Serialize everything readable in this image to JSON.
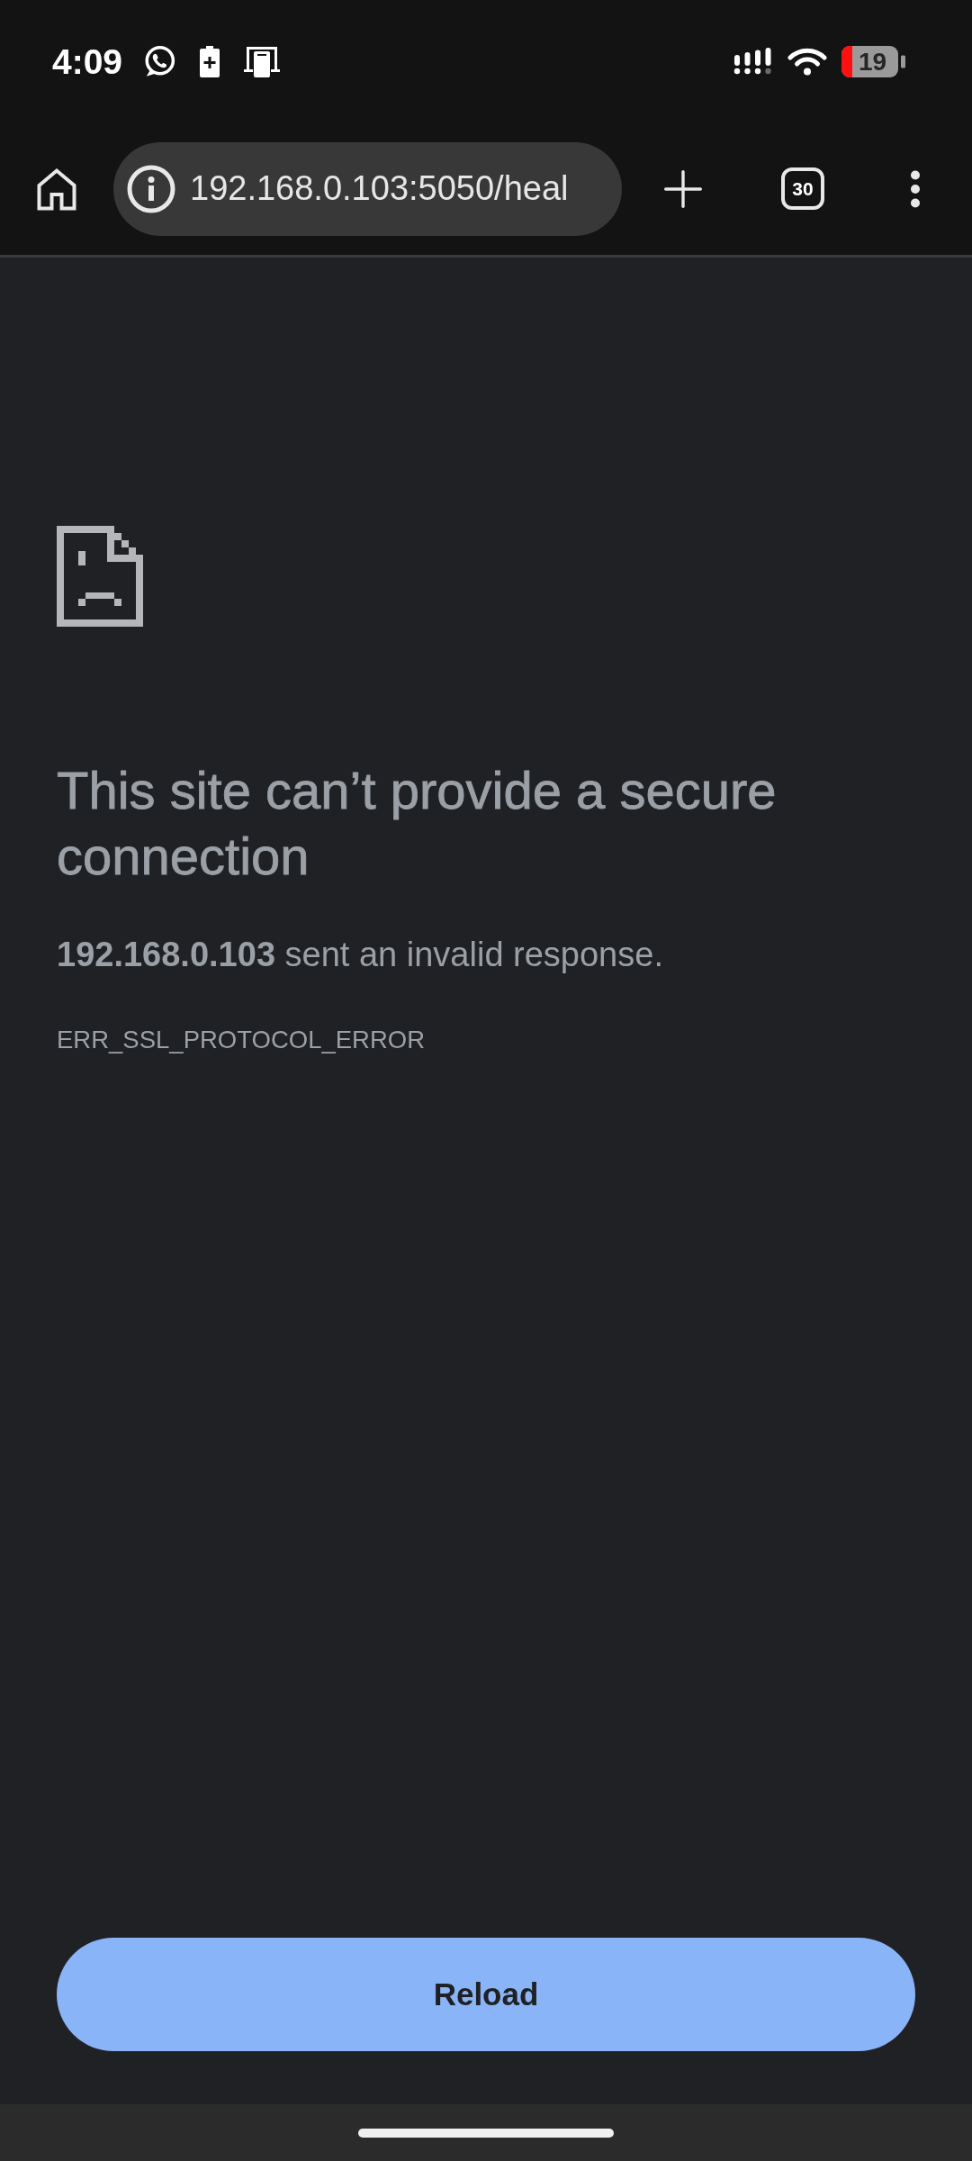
{
  "status_bar": {
    "time": "4:09",
    "battery_percent": "19"
  },
  "toolbar": {
    "url": "192.168.0.103:5050/heal",
    "tab_count": "30"
  },
  "error_page": {
    "title": "This site can’t provide a secure connection",
    "message": "**192.168.0.103** sent an invalid response.",
    "error_code": "ERR_SSL_PROTOCOL_ERROR"
  },
  "reload_button": {
    "label": "Reload"
  }
}
